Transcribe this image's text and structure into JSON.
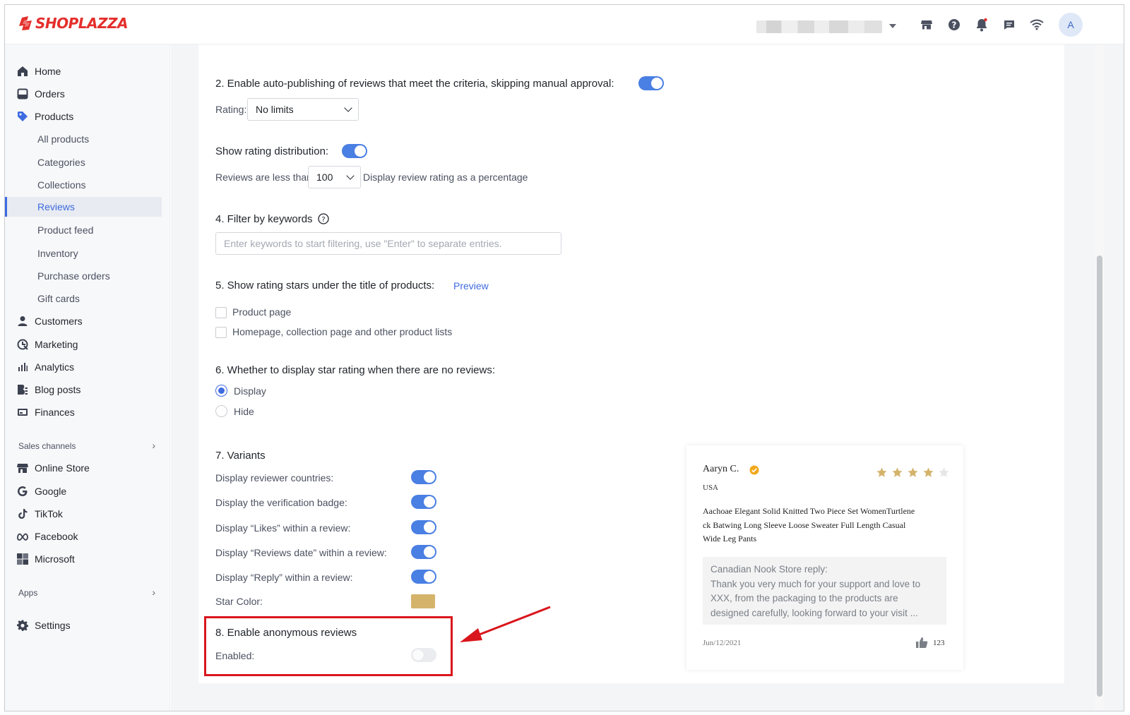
{
  "app": {
    "logo_text": "SHOPLAZZA",
    "brand_color": "#e42f2c",
    "accent_color": "#3e6be0",
    "avatar_letter": "A"
  },
  "header_icons": [
    "store-icon",
    "help-icon",
    "bell-icon",
    "chat-icon",
    "wifi-icon"
  ],
  "sidebar": {
    "items": [
      {
        "label": "Home",
        "icon": "home-icon"
      },
      {
        "label": "Orders",
        "icon": "orders-icon"
      },
      {
        "label": "Products",
        "icon": "tag-icon"
      },
      {
        "label": "Customers",
        "icon": "person-icon"
      },
      {
        "label": "Marketing",
        "icon": "marketing-icon"
      },
      {
        "label": "Analytics",
        "icon": "analytics-icon"
      },
      {
        "label": "Blog posts",
        "icon": "blog-icon"
      },
      {
        "label": "Finances",
        "icon": "finances-icon"
      }
    ],
    "product_sub": [
      "All products",
      "Categories",
      "Collections",
      "Reviews",
      "Product feed",
      "Inventory",
      "Purchase orders",
      "Gift cards"
    ],
    "active_sub": "Reviews",
    "sales_channels_label": "Sales channels",
    "channels": [
      {
        "label": "Online Store",
        "icon": "store-icon"
      },
      {
        "label": "Google",
        "icon": "google-icon"
      },
      {
        "label": "TikTok",
        "icon": "tiktok-icon"
      },
      {
        "label": "Facebook",
        "icon": "meta-icon"
      },
      {
        "label": "Microsoft",
        "icon": "microsoft-icon"
      }
    ],
    "apps_label": "Apps",
    "settings_label": "Settings"
  },
  "settings": {
    "auto_publish": {
      "label": "2. Enable auto-publishing of reviews that meet the criteria, skipping manual approval",
      "enabled": true,
      "rating_label": "Rating",
      "rating_value": "No limits"
    },
    "rating_distribution": {
      "label": "Show rating distribution",
      "enabled": true,
      "prefix": "Reviews are less than",
      "threshold": "100",
      "suffix": "Display review rating as a percentage"
    },
    "filter_keywords": {
      "label": "4. Filter by keywords",
      "placeholder": "Enter keywords to start filtering, use \"Enter\" to separate entries."
    },
    "rating_stars": {
      "label": "5. Show rating stars under the title of products",
      "preview_link": "Preview",
      "options": [
        "Product page",
        "Homepage, collection page and other product lists"
      ]
    },
    "no_reviews": {
      "label": "6. Whether to display star rating when there are no reviews:",
      "options": [
        "Display",
        "Hide"
      ],
      "selected": "Display"
    },
    "variants": {
      "label": "7. Variants",
      "toggles": [
        {
          "label": "Display reviewer countries",
          "enabled": true
        },
        {
          "label": "Display the verification badge",
          "enabled": true
        },
        {
          "label": "Display “Likes” within a review",
          "enabled": true
        },
        {
          "label": "Display “Reviews date” within a review",
          "enabled": true
        },
        {
          "label": "Display “Reply” within a review",
          "enabled": true
        }
      ],
      "star_color_label": "Star Color",
      "star_color": "#d4b36a"
    },
    "anonymous": {
      "label": "8. Enable anonymous reviews",
      "enabled_label": "Enabled",
      "enabled": false
    }
  },
  "preview_card": {
    "reviewer": "Aaryn C.",
    "country": "USA",
    "rating": 4,
    "max_rating": 5,
    "title_line1": "Aachoae Elegant Solid Knitted Two Piece Set WomenTurtlene",
    "title_line2": "ck Batwing Long Sleeve Loose Sweater Full  Length Casual",
    "title_line3": "Wide Leg Pants",
    "reply_line1": "Canadian Nook Store reply:",
    "reply_line2": "Thank you very much for your support and love to",
    "reply_line3": "XXX, from the packaging to the products are",
    "reply_line4": "designed carefully, looking forward to your visit ...",
    "date": "Jun/12/2021",
    "likes": "123",
    "star_color": "#d4b36a",
    "badge_color": "#f2a81c"
  }
}
